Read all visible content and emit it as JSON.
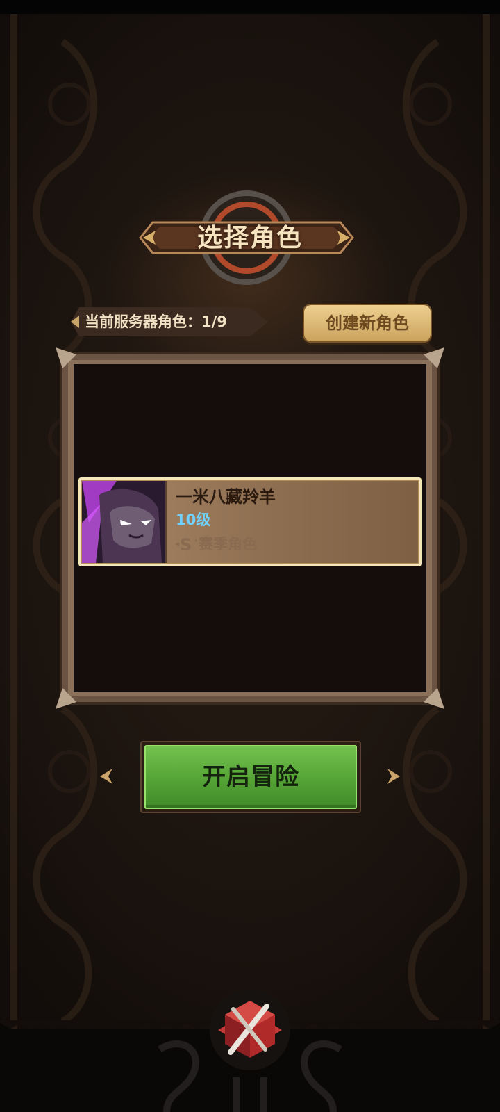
{
  "title": "选择角色",
  "server": {
    "label": "当前服务器角色：1/9"
  },
  "create_button": {
    "label": "创建新角色"
  },
  "characters": [
    {
      "name": "一米八藏羚羊",
      "level": "10级",
      "season_badge": "赛季角色",
      "avatar_icon": "purple-hooded-character-portrait"
    }
  ],
  "start_button": {
    "label": "开启冒险"
  },
  "colors": {
    "start_button_green": "#5aa93a",
    "level_blue": "#6fd2ff",
    "create_button_gold": "#e2bf7c",
    "panel_brown": "#221812"
  },
  "icons": {
    "bottom_emblem": "crossed-swords-emblem-icon",
    "season": "season-s-icon"
  }
}
